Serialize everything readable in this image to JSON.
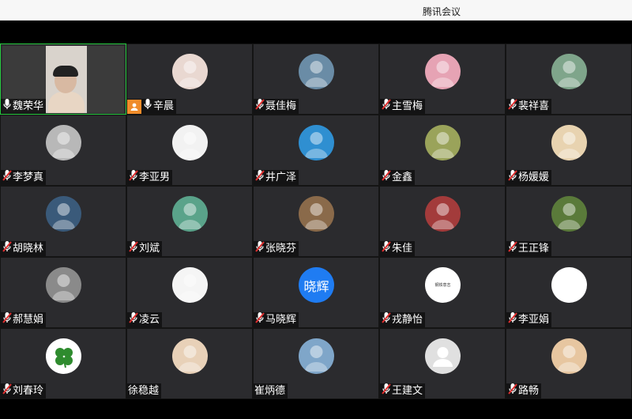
{
  "window": {
    "title": "腾讯会议"
  },
  "participants": [
    {
      "name": "魏荣华",
      "avatar_color": "#3b3b3b",
      "video": true,
      "mic": "on",
      "active": true
    },
    {
      "name": "辛晨",
      "avatar_color": "#e9d8d1",
      "mic": "on",
      "host": true
    },
    {
      "name": "聂佳梅",
      "avatar_color": "#6a8ca6",
      "mic": "muted"
    },
    {
      "name": "主雪梅",
      "avatar_color": "#e6a3b4",
      "mic": "muted"
    },
    {
      "name": "裴祥喜",
      "avatar_color": "#7fa58b",
      "mic": "muted"
    },
    {
      "name": "李梦真",
      "avatar_color": "#b8b8b8",
      "mic": "muted"
    },
    {
      "name": "李亚男",
      "avatar_color": "#f2f2f2",
      "mic": "muted"
    },
    {
      "name": "井广泽",
      "avatar_color": "#2f8fd1",
      "mic": "muted"
    },
    {
      "name": "金鑫",
      "avatar_color": "#9aa35a",
      "mic": "muted"
    },
    {
      "name": "杨媛媛",
      "avatar_color": "#e8d3b0",
      "mic": "muted"
    },
    {
      "name": "胡晓林",
      "avatar_color": "#3a5a7a",
      "mic": "muted"
    },
    {
      "name": "刘斌",
      "avatar_color": "#5aa38a",
      "mic": "muted"
    },
    {
      "name": "张晓芬",
      "avatar_color": "#8a6a4a",
      "mic": "muted"
    },
    {
      "name": "朱佳",
      "avatar_color": "#a33b3b",
      "mic": "muted"
    },
    {
      "name": "王正锋",
      "avatar_color": "#5a7a3a",
      "mic": "muted"
    },
    {
      "name": "郝慧娟",
      "avatar_color": "#8a8a8a",
      "mic": "muted"
    },
    {
      "name": "凌云",
      "avatar_color": "#f5f5f5",
      "mic": "muted"
    },
    {
      "name": "马晓辉",
      "avatar_color": "#1f7cf2",
      "avatar_text": "晓辉",
      "mic": "muted"
    },
    {
      "name": "戎静怡",
      "avatar_color": "#ffffff",
      "avatar_small_text": "钢铁意志",
      "mic": "muted"
    },
    {
      "name": "李亚娟",
      "avatar_color": "#ffffff",
      "mic": "muted"
    },
    {
      "name": "刘春玲",
      "avatar_color": "#ffffff",
      "mic": "muted",
      "icon": "clover-icon"
    },
    {
      "name": "徐稳越",
      "avatar_color": "#e8d1b8",
      "mic": "none"
    },
    {
      "name": "崔炳德",
      "avatar_color": "#7fa6c9",
      "mic": "none"
    },
    {
      "name": "王建文",
      "avatar_color": "#e0e0e0",
      "mic": "muted",
      "icon": "default-user-icon"
    },
    {
      "name": "路畅",
      "avatar_color": "#e7c6a0",
      "mic": "muted"
    }
  ],
  "colors": {
    "tile_bg": "#2b2b2e",
    "active_border": "#27c93f",
    "host_badge": "#f08c2a",
    "muted_red": "#e02f2f"
  }
}
